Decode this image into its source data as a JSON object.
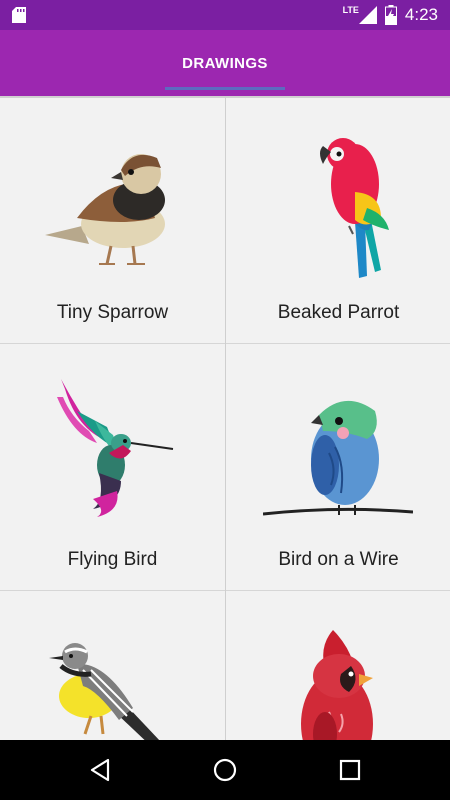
{
  "status_bar": {
    "time": "4:23",
    "network": "LTE"
  },
  "app_bar": {
    "tab_label": "DRAWINGS"
  },
  "drawings": [
    {
      "label": "Tiny Sparrow"
    },
    {
      "label": "Beaked Parrot"
    },
    {
      "label": "Flying Bird"
    },
    {
      "label": "Bird on a Wire"
    },
    {
      "label": ""
    },
    {
      "label": ""
    }
  ],
  "colors": {
    "status_bar": "#7b1fa2",
    "app_bar": "#9c27b0",
    "tab_indicator": "#5c6bc0",
    "grid_background": "#f2f2f2"
  },
  "icons": [
    "sd-card-icon",
    "lte-signal-icon",
    "battery-charging-icon",
    "back-icon",
    "home-icon",
    "recents-icon"
  ]
}
